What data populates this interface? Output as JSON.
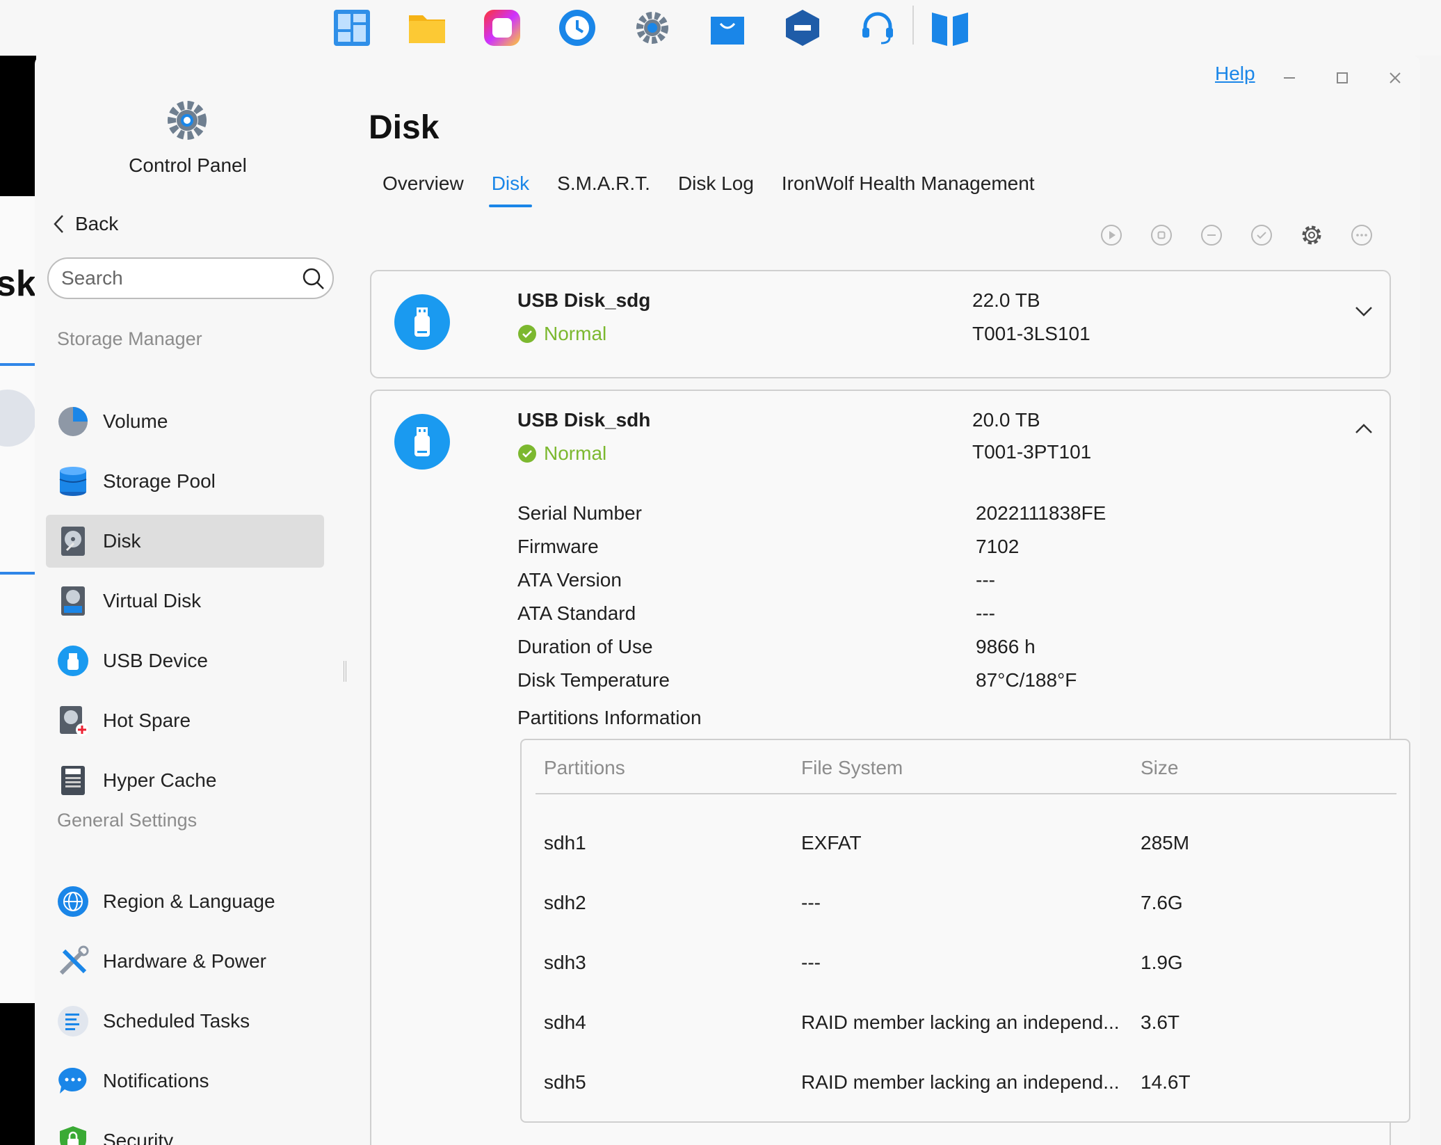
{
  "window": {
    "help_label": "Help",
    "app_title": "Control Panel",
    "back_label": "Back",
    "search_placeholder": "Search"
  },
  "desktop": {
    "partial_text": "sks"
  },
  "sidebar": {
    "sections": [
      {
        "heading": "Storage Manager",
        "items": [
          {
            "label": "Volume",
            "icon": "volume-icon"
          },
          {
            "label": "Storage Pool",
            "icon": "storage-pool-icon"
          },
          {
            "label": "Disk",
            "icon": "disk-icon",
            "active": true
          },
          {
            "label": "Virtual Disk",
            "icon": "virtual-disk-icon"
          },
          {
            "label": "USB Device",
            "icon": "usb-device-icon"
          },
          {
            "label": "Hot Spare",
            "icon": "hot-spare-icon"
          },
          {
            "label": "Hyper Cache",
            "icon": "hyper-cache-icon"
          }
        ]
      },
      {
        "heading": "General Settings",
        "items": [
          {
            "label": "Region & Language",
            "icon": "globe-icon"
          },
          {
            "label": "Hardware & Power",
            "icon": "tools-icon"
          },
          {
            "label": "Scheduled Tasks",
            "icon": "tasks-icon"
          },
          {
            "label": "Notifications",
            "icon": "chat-bubble-icon"
          },
          {
            "label": "Security",
            "icon": "shield-lock-icon"
          }
        ]
      }
    ]
  },
  "main": {
    "title": "Disk",
    "tabs": [
      "Overview",
      "Disk",
      "S.M.A.R.T.",
      "Disk Log",
      "IronWolf Health Management"
    ],
    "active_tab": "Disk",
    "toolbar_icons": [
      "play-icon",
      "stop-icon",
      "minus-icon",
      "check-icon",
      "gear-icon",
      "more-icon"
    ],
    "disks": [
      {
        "name": "USB Disk_sdg",
        "status": "Normal",
        "capacity": "22.0 TB",
        "model": "T001-3LS101",
        "expanded": false
      },
      {
        "name": "USB Disk_sdh",
        "status": "Normal",
        "capacity": "20.0 TB",
        "model": "T001-3PT101",
        "expanded": true,
        "details": [
          {
            "label": "Serial Number",
            "value": "2022111838FE"
          },
          {
            "label": "Firmware",
            "value": "7102"
          },
          {
            "label": "ATA Version",
            "value": "---"
          },
          {
            "label": "ATA Standard",
            "value": "---"
          },
          {
            "label": "Duration of Use",
            "value": "9866 h"
          },
          {
            "label": "Disk Temperature",
            "value": "87°C/188°F"
          }
        ],
        "partitions_title": "Partitions Information",
        "partition_columns": [
          "Partitions",
          "File System",
          "Size"
        ],
        "partitions": [
          {
            "name": "sdh1",
            "fs": "EXFAT",
            "size": "285M"
          },
          {
            "name": "sdh2",
            "fs": "---",
            "size": "7.6G"
          },
          {
            "name": "sdh3",
            "fs": "---",
            "size": "1.9G"
          },
          {
            "name": "sdh4",
            "fs": "RAID member lacking an independ...",
            "size": "3.6T"
          },
          {
            "name": "sdh5",
            "fs": "RAID member lacking an independ...",
            "size": "14.6T"
          }
        ]
      }
    ]
  },
  "colors": {
    "accent": "#1a86e8",
    "status_ok": "#7cb82f"
  }
}
